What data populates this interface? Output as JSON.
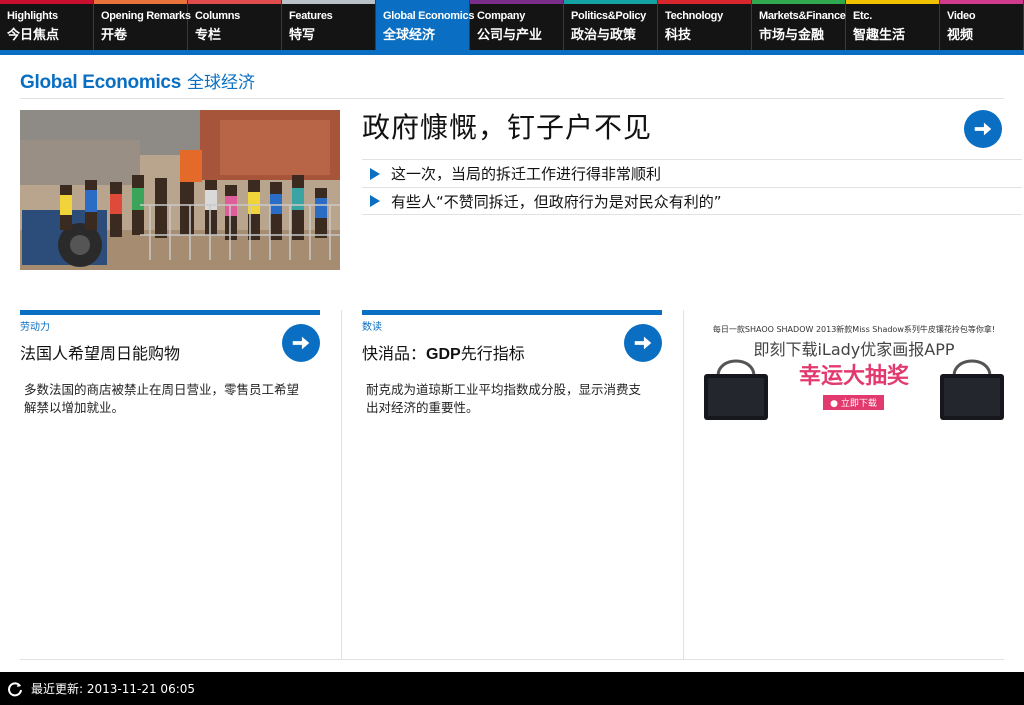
{
  "nav": {
    "items": [
      {
        "en": "Highlights",
        "zh": "今日焦点",
        "color": "#c8102e"
      },
      {
        "en": "Opening Remarks",
        "zh": "开卷",
        "color": "#e8743b"
      },
      {
        "en": "Columns",
        "zh": "专栏",
        "color": "#e04b4b"
      },
      {
        "en": "Features",
        "zh": "特写",
        "color": "#b9c1c9"
      },
      {
        "en": "Global Economics",
        "zh": "全球经济",
        "color": "#0a6fc2"
      },
      {
        "en": "Company",
        "zh": "公司与产业",
        "color": "#7b2d8b"
      },
      {
        "en": "Politics&Policy",
        "zh": "政治与政策",
        "color": "#14a3a3"
      },
      {
        "en": "Technology",
        "zh": "科技",
        "color": "#d9262c"
      },
      {
        "en": "Markets&Finance",
        "zh": "市场与金融",
        "color": "#2fa84f"
      },
      {
        "en": "Etc.",
        "zh": "智趣生活",
        "color": "#f2c200"
      },
      {
        "en": "Video",
        "zh": "视频",
        "color": "#d23b8c"
      }
    ],
    "active_index": 4
  },
  "section": {
    "title_en": "Global Economics",
    "title_zh": "全球经济"
  },
  "lead": {
    "headline": "政府慷慨，钉子户不见",
    "bullets": [
      "这一次，当局的拆迁工作进行得非常顺利",
      "有些人“不赞同拆迁，但政府行为是对民众有利的”"
    ]
  },
  "cards": [
    {
      "kicker": "劳动力",
      "title_plain": "法国人希望周日能购物",
      "title_bold": "",
      "title_rest": "",
      "summary": "多数法国的商店被禁止在周日营业，零售员工希望解禁以增加就业。"
    },
    {
      "kicker": "数读",
      "title_plain": "快消品：",
      "title_bold": "GDP",
      "title_rest": "先行指标",
      "summary": "耐克成为道琼斯工业平均指数成分股，显示消费支出对经济的重要性。"
    }
  ],
  "ad": {
    "line1": "每日一款SHAOO SHADOW 2013新款Miss Shadow系列牛皮镶花拎包等你拿!",
    "line2": "即刻下载iLady优家画报APP",
    "line3": "幸运大抽奖",
    "cta": "● 立即下载"
  },
  "footer": {
    "label": "最近更新:",
    "timestamp": "2013-11-21 06:05"
  },
  "colors": {
    "accent": "#0a6fc2",
    "nav_bg": "#141414",
    "ad_pink": "#e23a6e"
  }
}
